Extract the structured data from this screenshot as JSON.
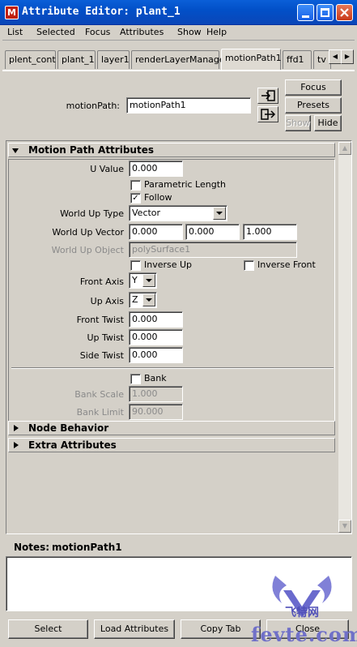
{
  "window": {
    "title": "Attribute Editor: plant_1"
  },
  "menu": [
    "List",
    "Selected",
    "Focus",
    "Attributes",
    "Show",
    "Help"
  ],
  "tabs": [
    "plent_cont",
    "plant_1",
    "layer1",
    "renderLayerManager",
    "motionPath1",
    "ffd1",
    "tv"
  ],
  "active_tab": "motionPath1",
  "node": {
    "label": "motionPath:",
    "value": "motionPath1",
    "buttons": {
      "focus": "Focus",
      "presets": "Presets",
      "show": "Show",
      "hide": "Hide"
    }
  },
  "sections": {
    "motion_path": {
      "title": "Motion Path Attributes",
      "u_value": {
        "label": "U Value",
        "value": "0.000"
      },
      "parametric_length": {
        "label": "Parametric Length",
        "checked": false
      },
      "follow": {
        "label": "Follow",
        "checked": true
      },
      "world_up_type": {
        "label": "World Up Type",
        "value": "Vector"
      },
      "world_up_vector": {
        "label": "World Up Vector",
        "x": "0.000",
        "y": "0.000",
        "z": "1.000"
      },
      "world_up_object": {
        "label": "World Up Object",
        "value": "polySurface1"
      },
      "inverse_up": {
        "label": "Inverse Up",
        "checked": false
      },
      "inverse_front": {
        "label": "Inverse Front",
        "checked": false
      },
      "front_axis": {
        "label": "Front Axis",
        "value": "Y"
      },
      "up_axis": {
        "label": "Up Axis",
        "value": "Z"
      },
      "front_twist": {
        "label": "Front Twist",
        "value": "0.000"
      },
      "up_twist": {
        "label": "Up Twist",
        "value": "0.000"
      },
      "side_twist": {
        "label": "Side Twist",
        "value": "0.000"
      },
      "bank": {
        "label": "Bank",
        "checked": false
      },
      "bank_scale": {
        "label": "Bank Scale",
        "value": "1.000"
      },
      "bank_limit": {
        "label": "Bank Limit",
        "value": "90.000"
      }
    },
    "node_behavior": {
      "title": "Node Behavior"
    },
    "extra_attributes": {
      "title": "Extra Attributes"
    }
  },
  "notes": {
    "label": "Notes:",
    "node": "motionPath1",
    "text": ""
  },
  "bottom_buttons": {
    "select": "Select",
    "load": "Load Attributes",
    "copy_tab": "Copy Tab",
    "close": "Close"
  },
  "watermark": {
    "text": "fevte.com",
    "logo_text": "飞特网"
  },
  "colors": {
    "titlebar": "#0a5fd8",
    "face": "#d4d0c8",
    "close_button": "#c83818"
  }
}
